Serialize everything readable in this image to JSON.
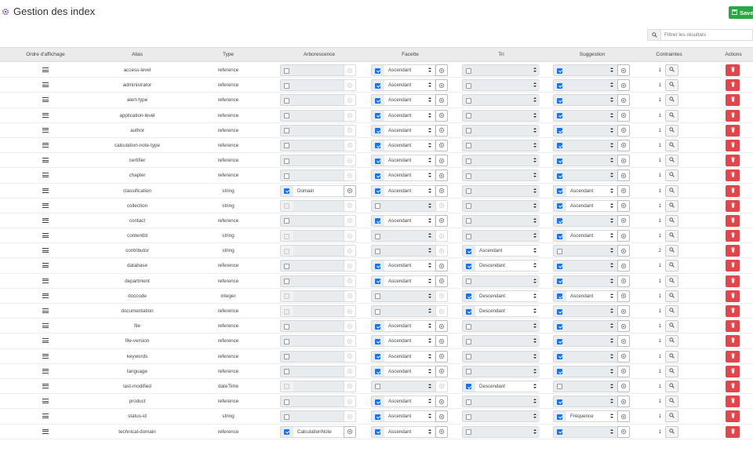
{
  "header": {
    "title": "Gestion des index",
    "title_icon": "gear-icon",
    "save_label": "Save"
  },
  "filter": {
    "placeholder": "Filtrer les résultats",
    "icon": "search-icon"
  },
  "columns": [
    "Ordre d'affichage",
    "Alias",
    "Type",
    "Arborescence",
    "Facette",
    "Tri",
    "Suggestion",
    "Contraintes",
    "Actions"
  ],
  "colors": {
    "save": "#28a745",
    "delete": "#e0474c",
    "checkbox": "#1a73e8",
    "header_bg": "#ebebeb"
  },
  "rows": [
    {
      "alias": "access-level",
      "type": "reference",
      "arbo": {
        "state": "off",
        "value": ""
      },
      "facette": {
        "state": "on",
        "value": "Ascendant"
      },
      "tri": {
        "state": "off",
        "value": ""
      },
      "suggestion": {
        "state": "on",
        "value": ""
      },
      "count": "1"
    },
    {
      "alias": "administrator",
      "type": "reference",
      "arbo": {
        "state": "off",
        "value": ""
      },
      "facette": {
        "state": "on",
        "value": "Ascendant"
      },
      "tri": {
        "state": "off",
        "value": ""
      },
      "suggestion": {
        "state": "on",
        "value": ""
      },
      "count": "1"
    },
    {
      "alias": "alert-type",
      "type": "reference",
      "arbo": {
        "state": "off",
        "value": ""
      },
      "facette": {
        "state": "on",
        "value": "Ascendant"
      },
      "tri": {
        "state": "off",
        "value": ""
      },
      "suggestion": {
        "state": "on",
        "value": ""
      },
      "count": "1"
    },
    {
      "alias": "application-level",
      "type": "reference",
      "arbo": {
        "state": "off",
        "value": ""
      },
      "facette": {
        "state": "on",
        "value": "Ascendant"
      },
      "tri": {
        "state": "off",
        "value": ""
      },
      "suggestion": {
        "state": "on",
        "value": ""
      },
      "count": "1"
    },
    {
      "alias": "author",
      "type": "reference",
      "arbo": {
        "state": "off",
        "value": ""
      },
      "facette": {
        "state": "on",
        "value": "Ascendant"
      },
      "tri": {
        "state": "off",
        "value": ""
      },
      "suggestion": {
        "state": "on",
        "value": ""
      },
      "count": "1"
    },
    {
      "alias": "calculation-note-type",
      "type": "reference",
      "arbo": {
        "state": "off",
        "value": ""
      },
      "facette": {
        "state": "on",
        "value": "Ascendant"
      },
      "tri": {
        "state": "off",
        "value": ""
      },
      "suggestion": {
        "state": "on",
        "value": ""
      },
      "count": "1"
    },
    {
      "alias": "certifier",
      "type": "reference",
      "arbo": {
        "state": "off",
        "value": ""
      },
      "facette": {
        "state": "on",
        "value": "Ascendant"
      },
      "tri": {
        "state": "off",
        "value": ""
      },
      "suggestion": {
        "state": "on",
        "value": ""
      },
      "count": "1"
    },
    {
      "alias": "chapter",
      "type": "reference",
      "arbo": {
        "state": "off",
        "value": ""
      },
      "facette": {
        "state": "on",
        "value": "Ascendant"
      },
      "tri": {
        "state": "off",
        "value": ""
      },
      "suggestion": {
        "state": "on",
        "value": ""
      },
      "count": "1"
    },
    {
      "alias": "classification",
      "type": "string",
      "arbo": {
        "state": "on",
        "value": "Domain"
      },
      "facette": {
        "state": "on",
        "value": "Ascendant"
      },
      "tri": {
        "state": "off",
        "value": ""
      },
      "suggestion": {
        "state": "on",
        "value": "Ascendant"
      },
      "count": "1"
    },
    {
      "alias": "collection",
      "type": "string",
      "arbo": {
        "state": "dis",
        "value": ""
      },
      "facette": {
        "state": "off",
        "value": ""
      },
      "tri": {
        "state": "off",
        "value": ""
      },
      "suggestion": {
        "state": "on",
        "value": "Ascendant"
      },
      "count": "1"
    },
    {
      "alias": "contact",
      "type": "reference",
      "arbo": {
        "state": "off",
        "value": ""
      },
      "facette": {
        "state": "on",
        "value": "Ascendant"
      },
      "tri": {
        "state": "off",
        "value": ""
      },
      "suggestion": {
        "state": "on",
        "value": ""
      },
      "count": "1"
    },
    {
      "alias": "contentId",
      "type": "string",
      "arbo": {
        "state": "dis",
        "value": ""
      },
      "facette": {
        "state": "off",
        "value": ""
      },
      "tri": {
        "state": "off",
        "value": ""
      },
      "suggestion": {
        "state": "on",
        "value": "Ascendant"
      },
      "count": "1"
    },
    {
      "alias": "contributor",
      "type": "string",
      "arbo": {
        "state": "dis",
        "value": ""
      },
      "facette": {
        "state": "off",
        "value": ""
      },
      "tri": {
        "state": "on",
        "value": "Ascendant"
      },
      "suggestion": {
        "state": "off",
        "value": ""
      },
      "count": "2"
    },
    {
      "alias": "database",
      "type": "reference",
      "arbo": {
        "state": "off",
        "value": ""
      },
      "facette": {
        "state": "on",
        "value": "Ascendant"
      },
      "tri": {
        "state": "on",
        "value": "Descendant"
      },
      "suggestion": {
        "state": "on",
        "value": ""
      },
      "count": "1"
    },
    {
      "alias": "department",
      "type": "reference",
      "arbo": {
        "state": "off",
        "value": ""
      },
      "facette": {
        "state": "on",
        "value": "Ascendant"
      },
      "tri": {
        "state": "off",
        "value": ""
      },
      "suggestion": {
        "state": "on",
        "value": ""
      },
      "count": "1"
    },
    {
      "alias": "doccode",
      "type": "integer",
      "arbo": {
        "state": "dis",
        "value": ""
      },
      "facette": {
        "state": "off",
        "value": ""
      },
      "tri": {
        "state": "on",
        "value": "Descendant"
      },
      "suggestion": {
        "state": "on",
        "value": "Ascendant"
      },
      "count": "1"
    },
    {
      "alias": "documentation",
      "type": "reference",
      "arbo": {
        "state": "dis",
        "value": ""
      },
      "facette": {
        "state": "off",
        "value": ""
      },
      "tri": {
        "state": "on",
        "value": "Descendant"
      },
      "suggestion": {
        "state": "on",
        "value": ""
      },
      "count": "1"
    },
    {
      "alias": "file",
      "type": "reference",
      "arbo": {
        "state": "off",
        "value": ""
      },
      "facette": {
        "state": "on",
        "value": "Ascendant"
      },
      "tri": {
        "state": "off",
        "value": ""
      },
      "suggestion": {
        "state": "on",
        "value": ""
      },
      "count": "1"
    },
    {
      "alias": "file-version",
      "type": "reference",
      "arbo": {
        "state": "off",
        "value": ""
      },
      "facette": {
        "state": "on",
        "value": "Ascendant"
      },
      "tri": {
        "state": "off",
        "value": ""
      },
      "suggestion": {
        "state": "on",
        "value": ""
      },
      "count": "1"
    },
    {
      "alias": "keywords",
      "type": "reference",
      "arbo": {
        "state": "off",
        "value": ""
      },
      "facette": {
        "state": "on",
        "value": "Ascendant"
      },
      "tri": {
        "state": "off",
        "value": ""
      },
      "suggestion": {
        "state": "on",
        "value": ""
      },
      "count": "1"
    },
    {
      "alias": "language",
      "type": "reference",
      "arbo": {
        "state": "off",
        "value": ""
      },
      "facette": {
        "state": "on",
        "value": "Ascendant"
      },
      "tri": {
        "state": "off",
        "value": ""
      },
      "suggestion": {
        "state": "on",
        "value": ""
      },
      "count": "1"
    },
    {
      "alias": "last-modified",
      "type": "dateTime",
      "arbo": {
        "state": "dis",
        "value": ""
      },
      "facette": {
        "state": "off",
        "value": ""
      },
      "tri": {
        "state": "on",
        "value": "Descendant"
      },
      "suggestion": {
        "state": "off",
        "value": ""
      },
      "count": "1"
    },
    {
      "alias": "product",
      "type": "reference",
      "arbo": {
        "state": "off",
        "value": ""
      },
      "facette": {
        "state": "on",
        "value": "Ascendant"
      },
      "tri": {
        "state": "off",
        "value": ""
      },
      "suggestion": {
        "state": "on",
        "value": ""
      },
      "count": "1"
    },
    {
      "alias": "status-id",
      "type": "string",
      "arbo": {
        "state": "off",
        "value": ""
      },
      "facette": {
        "state": "on",
        "value": "Ascendant"
      },
      "tri": {
        "state": "off",
        "value": ""
      },
      "suggestion": {
        "state": "on",
        "value": "Fréquence"
      },
      "count": "1"
    },
    {
      "alias": "technical-domain",
      "type": "reference",
      "arbo": {
        "state": "on",
        "value": "CalculationNote"
      },
      "facette": {
        "state": "on",
        "value": "Ascendant"
      },
      "tri": {
        "state": "off",
        "value": ""
      },
      "suggestion": {
        "state": "on",
        "value": ""
      },
      "count": "1"
    }
  ]
}
